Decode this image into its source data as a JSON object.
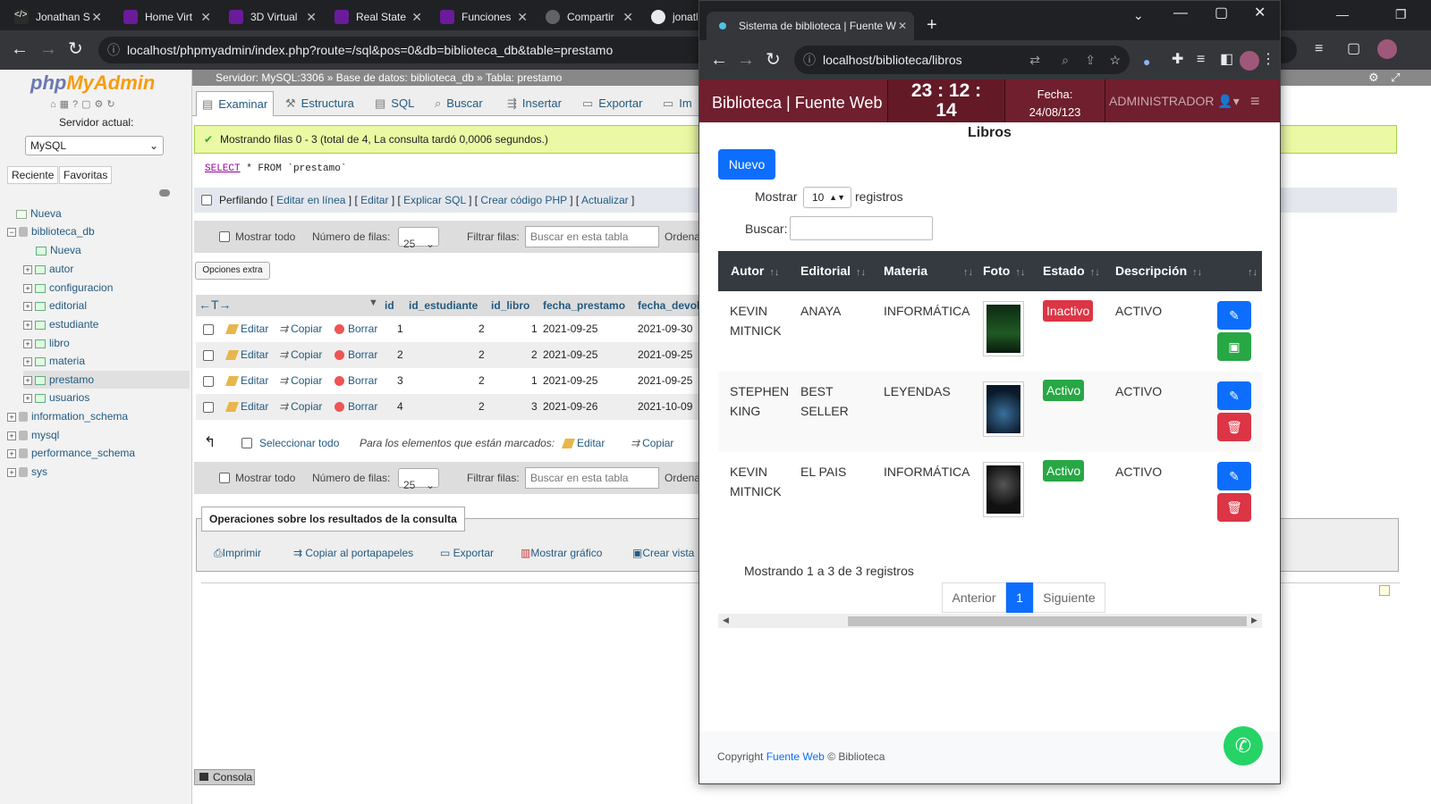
{
  "back_browser": {
    "tabs": [
      {
        "label": "Jonathan S",
        "color": "#2b2b2b"
      },
      {
        "label": "Home Virt",
        "color": "#6a1b9a"
      },
      {
        "label": "3D Virtual",
        "color": "#6a1b9a"
      },
      {
        "label": "Real State",
        "color": "#6a1b9a"
      },
      {
        "label": "Funciones",
        "color": "#6a1b9a"
      },
      {
        "label": "Compartir",
        "color": "#5f6368"
      },
      {
        "label": "jonath",
        "color": "#5f6368"
      }
    ],
    "url": "localhost/phpmyadmin/index.php?route=/sql&pos=0&db=biblioteca_db&table=prestamo"
  },
  "pma": {
    "logo_a": "php",
    "logo_b": "MyAdmin",
    "server_label": "Servidor actual:",
    "server_value": "MySQL",
    "recent": "Reciente",
    "favorites": "Favoritas",
    "tree": [
      "Nueva",
      "biblioteca_db",
      "Nueva",
      "autor",
      "configuracion",
      "editorial",
      "estudiante",
      "libro",
      "materia",
      "prestamo",
      "usuarios",
      "information_schema",
      "mysql",
      "performance_schema",
      "sys"
    ],
    "crumb": "Servidor: MySQL:3306  »  Base de datos: biblioteca_db  »  Tabla: prestamo",
    "tabs": [
      "Examinar",
      "Estructura",
      "SQL",
      "Buscar",
      "Insertar",
      "Exportar",
      "Im"
    ],
    "message": "Mostrando filas 0 - 3 (total de 4, La consulta tardó 0,0006 segundos.)",
    "sql_kw": "SELECT",
    "sql_rest": " * FROM `prestamo`",
    "profile": "Perfilando",
    "profile_links": [
      "Editar en línea",
      "Editar",
      "Explicar SQL",
      "Crear código PHP",
      "Actualizar"
    ],
    "nav": {
      "show_all": "Mostrar todo",
      "rows_label": "Número de filas:",
      "rows_value": "25",
      "filter_label": "Filtrar filas:",
      "filter_placeholder": "Buscar en esta tabla",
      "order": "Ordena"
    },
    "extra_options": "Opciones extra",
    "columns": [
      "id",
      "id_estudiante",
      "id_libro",
      "fecha_prestamo",
      "fecha_devol"
    ],
    "actions": {
      "edit": "Editar",
      "copy": "Copiar",
      "delete": "Borrar"
    },
    "rows": [
      {
        "id": "1",
        "est": "2",
        "lib": "1",
        "fp": "2021-09-25",
        "fd": "2021-09-30"
      },
      {
        "id": "2",
        "est": "2",
        "lib": "2",
        "fp": "2021-09-25",
        "fd": "2021-09-25"
      },
      {
        "id": "3",
        "est": "2",
        "lib": "1",
        "fp": "2021-09-25",
        "fd": "2021-09-25"
      },
      {
        "id": "4",
        "est": "2",
        "lib": "3",
        "fp": "2021-09-26",
        "fd": "2021-10-09"
      }
    ],
    "select_all": "Seleccionar todo",
    "marked": "Para los elementos que están marcados:",
    "ops_title": "Operaciones sobre los resultados de la consulta",
    "ops": [
      "Imprimir",
      "Copiar al portapapeles",
      "Exportar",
      "Mostrar gráfico",
      "Crear vista"
    ],
    "console": "Consola"
  },
  "front": {
    "tab_title": "Sistema de biblioteca | Fuente W",
    "url": "localhost/biblioteca/libros",
    "brand": "Biblioteca | Fuente Web",
    "clock_line1": "23 : 12 :",
    "clock_line2": "14",
    "date_label": "Fecha:",
    "date_value": "24/08/123",
    "admin": "ADMINISTRADOR",
    "page_title": "Libros",
    "new_button": "Nuevo",
    "show_label": "Mostrar",
    "show_value": "10",
    "records_label": "registros",
    "search_label": "Buscar:",
    "headers": [
      "Autor",
      "Editorial",
      "Materia",
      "Foto",
      "Estado",
      "Descripción"
    ],
    "books": [
      {
        "author_1": "KEVIN",
        "author_2": "MITNICK",
        "editorial_1": "ANAYA",
        "editorial_2": "",
        "subject": "INFORMÁTICA",
        "status": "Inactivo",
        "description": "ACTIVO"
      },
      {
        "author_1": "STEPHEN",
        "author_2": "KING",
        "editorial_1": "BEST",
        "editorial_2": "SELLER",
        "subject": "LEYENDAS",
        "status": "Activo",
        "description": "ACTIVO"
      },
      {
        "author_1": "KEVIN",
        "author_2": "MITNICK",
        "editorial_1": "EL PAIS",
        "editorial_2": "",
        "subject": "INFORMÁTICA",
        "status": "Activo",
        "description": "ACTIVO"
      }
    ],
    "info": "Mostrando 1 a 3 de 3 registros",
    "prev": "Anterior",
    "page": "1",
    "next": "Siguiente",
    "footer_a": "Copyright ",
    "footer_link": "Fuente Web",
    "footer_b": " © Biblioteca",
    "colors": {
      "header": "#6f1f2e",
      "primary": "#0d6efd",
      "success": "#28a745",
      "danger": "#dc3545",
      "dark": "#343a40"
    }
  }
}
